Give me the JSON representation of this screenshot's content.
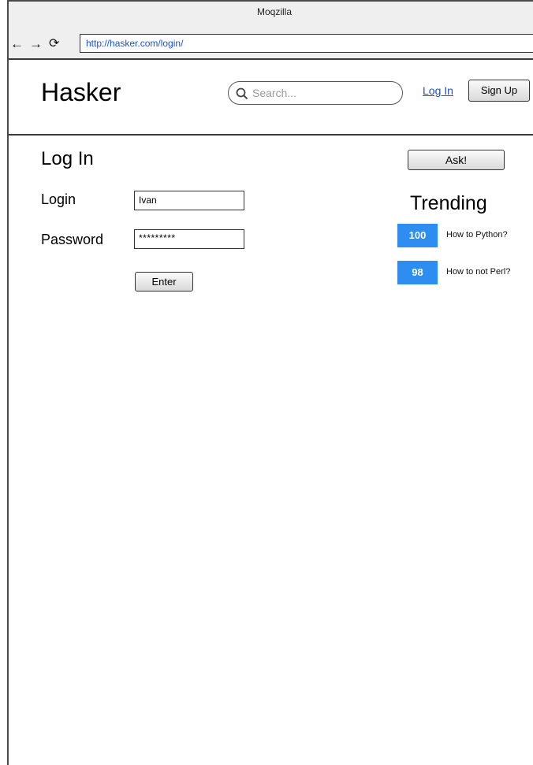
{
  "browser": {
    "title": "Moqzilla",
    "back_icon": "←",
    "forward_icon": "→",
    "reload_icon": "⟳",
    "url": "http://hasker.com/login/"
  },
  "header": {
    "brand": "Hasker",
    "search_placeholder": "Search...",
    "login_link": "Log In",
    "signup_label": "Sign Up"
  },
  "login_form": {
    "heading": "Log In",
    "login_label": "Login",
    "login_value": "Ivan",
    "password_label": "Password",
    "password_value": "*********",
    "enter_label": "Enter"
  },
  "sidebar": {
    "ask_label": "Ask!",
    "trending_title": "Trending",
    "trending": [
      {
        "votes": "100",
        "title": "How to Python?"
      },
      {
        "votes": "98",
        "title": "How to not Perl?"
      }
    ]
  },
  "colors": {
    "link": "#1a53c9",
    "badge": "#2d8df0"
  }
}
